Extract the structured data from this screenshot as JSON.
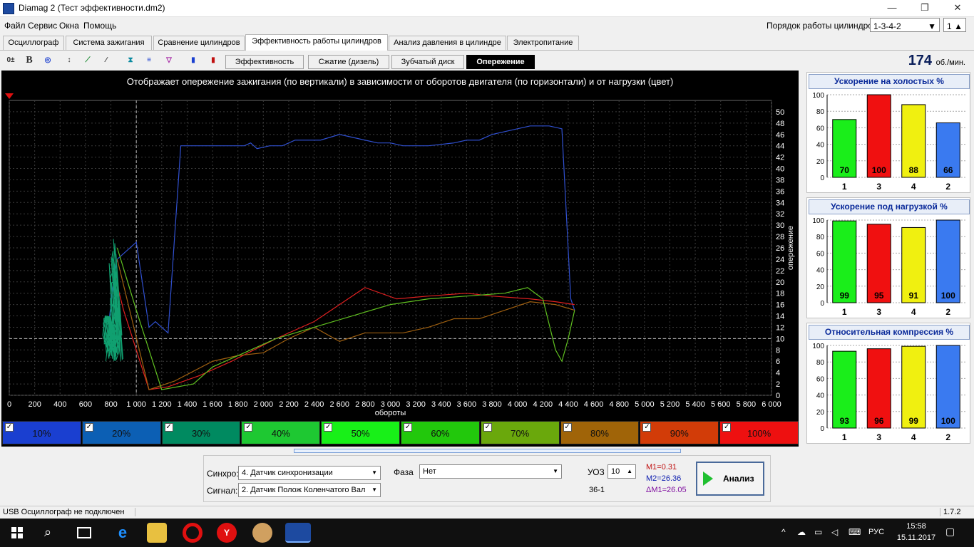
{
  "window": {
    "title": "Diamag 2 (Тест эффективности.dm2)",
    "min": "—",
    "max": "❐",
    "close": "✕"
  },
  "menu": [
    "Файл",
    "Сервис",
    "Окна",
    "Помощь"
  ],
  "firing_order": {
    "label": "Порядок работы цилиндров",
    "value": "1-3-4-2",
    "cyl_value": "1"
  },
  "main_tabs": [
    "Осциллограф",
    "Система зажигания",
    "Сравнение цилиндров",
    "Эффективность работы цилиндров",
    "Анализ давления в цилиндре",
    "Электропитание"
  ],
  "sub_tabs": [
    "Эффективность",
    "Сжатие (дизель)",
    "Зубчатый диск",
    "Опережение"
  ],
  "rpm": {
    "value": "174",
    "unit": "об./мин."
  },
  "chart_data": {
    "type": "line",
    "title": "Отображает опережение зажигания (по вертикали) в зависимости от оборотов двигателя (по горизонтали) и от нагрузки (цвет)",
    "xlabel": "обороты",
    "ylabel": "опережение",
    "xlim": [
      0,
      6000
    ],
    "ylim": [
      0,
      52
    ],
    "x_ticks": [
      "0",
      "200",
      "400",
      "600",
      "800",
      "1 000",
      "1 200",
      "1 400",
      "1 600",
      "1 800",
      "2 000",
      "2 200",
      "2 400",
      "2 600",
      "2 800",
      "3 000",
      "3 200",
      "3 400",
      "3 600",
      "3 800",
      "4 000",
      "4 200",
      "4 400",
      "4 600",
      "4 800",
      "5 000",
      "5 200",
      "5 400",
      "5 600",
      "5 800",
      "6 000"
    ],
    "y_ticks": [
      "0",
      "2",
      "4",
      "6",
      "8",
      "10",
      "12",
      "14",
      "16",
      "18",
      "20",
      "22",
      "24",
      "26",
      "28",
      "30",
      "32",
      "34",
      "36",
      "38",
      "40",
      "42",
      "44",
      "46",
      "48",
      "50"
    ],
    "series": [
      {
        "color": "#3050d0",
        "points": [
          [
            780,
            12
          ],
          [
            820,
            20
          ],
          [
            850,
            24
          ],
          [
            1000,
            27
          ],
          [
            1100,
            12
          ],
          [
            1150,
            13
          ],
          [
            1250,
            11
          ],
          [
            1350,
            44
          ],
          [
            1500,
            44
          ],
          [
            1700,
            44
          ],
          [
            1850,
            44
          ],
          [
            1900,
            44.5
          ],
          [
            1950,
            43.5
          ],
          [
            2050,
            44
          ],
          [
            2150,
            44
          ],
          [
            2250,
            45
          ],
          [
            2450,
            45
          ],
          [
            2600,
            46
          ],
          [
            2700,
            45.5
          ],
          [
            2800,
            45
          ],
          [
            2900,
            44.5
          ],
          [
            3000,
            44.5
          ],
          [
            3100,
            44
          ],
          [
            3300,
            44
          ],
          [
            3500,
            44.5
          ],
          [
            3600,
            45
          ],
          [
            3700,
            45
          ],
          [
            3800,
            46
          ],
          [
            3900,
            46.5
          ],
          [
            4000,
            47
          ],
          [
            4100,
            47.5
          ],
          [
            4250,
            47.5
          ],
          [
            4350,
            47
          ],
          [
            4420,
            17
          ],
          [
            4450,
            15
          ]
        ]
      },
      {
        "color": "#e02020",
        "points": [
          [
            820,
            22
          ],
          [
            900,
            15
          ],
          [
            1100,
            1
          ],
          [
            1250,
            1.5
          ],
          [
            1500,
            3.5
          ],
          [
            1750,
            6
          ],
          [
            2100,
            10
          ],
          [
            2400,
            13
          ],
          [
            2600,
            16
          ],
          [
            2800,
            19
          ],
          [
            3050,
            17
          ],
          [
            3300,
            17.5
          ],
          [
            3600,
            18
          ],
          [
            3800,
            17.5
          ],
          [
            4100,
            17
          ],
          [
            4300,
            16.5
          ],
          [
            4450,
            16
          ]
        ]
      },
      {
        "color": "#a06010",
        "points": [
          [
            850,
            24
          ],
          [
            1100,
            1
          ],
          [
            1300,
            2.5
          ],
          [
            1600,
            6
          ],
          [
            1800,
            7
          ],
          [
            2000,
            7.5
          ],
          [
            2200,
            10
          ],
          [
            2400,
            12
          ],
          [
            2600,
            9.5
          ],
          [
            2800,
            11
          ],
          [
            3100,
            11
          ],
          [
            3300,
            12
          ],
          [
            3500,
            13.5
          ],
          [
            3700,
            13.5
          ],
          [
            3900,
            15
          ],
          [
            4100,
            16.5
          ],
          [
            4300,
            16
          ],
          [
            4450,
            15
          ]
        ]
      },
      {
        "color": "#60c020",
        "points": [
          [
            850,
            26
          ],
          [
            1000,
            15
          ],
          [
            1200,
            1
          ],
          [
            1450,
            2
          ],
          [
            1600,
            5
          ],
          [
            1800,
            7
          ],
          [
            2100,
            10
          ],
          [
            2400,
            12
          ],
          [
            2700,
            14
          ],
          [
            3000,
            16
          ],
          [
            3300,
            17
          ],
          [
            3600,
            17.5
          ],
          [
            3900,
            18
          ],
          [
            4080,
            19
          ],
          [
            4200,
            17
          ],
          [
            4300,
            8
          ],
          [
            4350,
            6
          ],
          [
            4400,
            10
          ],
          [
            4450,
            15
          ]
        ]
      }
    ]
  },
  "load_bands": [
    {
      "label": "10%",
      "color": "#1a3fd0"
    },
    {
      "label": "20%",
      "color": "#0c5fb4"
    },
    {
      "label": "30%",
      "color": "#008a60"
    },
    {
      "label": "40%",
      "color": "#1ec832"
    },
    {
      "label": "50%",
      "color": "#18f018"
    },
    {
      "label": "60%",
      "color": "#22c80c"
    },
    {
      "label": "70%",
      "color": "#6aa80c"
    },
    {
      "label": "80%",
      "color": "#a06408"
    },
    {
      "label": "90%",
      "color": "#d23c08"
    },
    {
      "label": "100%",
      "color": "#ee1010"
    }
  ],
  "side_charts": [
    {
      "title": "Ускорение на холостых %",
      "bars": [
        {
          "cyl": "1",
          "value": 70,
          "color": "#1aee1a"
        },
        {
          "cyl": "3",
          "value": 100,
          "color": "#f01010"
        },
        {
          "cyl": "4",
          "value": 88,
          "color": "#f0f010"
        },
        {
          "cyl": "2",
          "value": 66,
          "color": "#3a7af0"
        }
      ]
    },
    {
      "title": "Ускорение под нагрузкой %",
      "bars": [
        {
          "cyl": "1",
          "value": 99,
          "color": "#1aee1a"
        },
        {
          "cyl": "3",
          "value": 95,
          "color": "#f01010"
        },
        {
          "cyl": "4",
          "value": 91,
          "color": "#f0f010"
        },
        {
          "cyl": "2",
          "value": 100,
          "color": "#3a7af0"
        }
      ]
    },
    {
      "title": "Относительная компрессия %",
      "bars": [
        {
          "cyl": "1",
          "value": 93,
          "color": "#1aee1a"
        },
        {
          "cyl": "3",
          "value": 96,
          "color": "#f01010"
        },
        {
          "cyl": "4",
          "value": 99,
          "color": "#f0f010"
        },
        {
          "cyl": "2",
          "value": 100,
          "color": "#3a7af0"
        }
      ]
    }
  ],
  "side_yticks": [
    "0",
    "20",
    "40",
    "60",
    "80",
    "100"
  ],
  "controls": {
    "sync_label": "Синхро:",
    "sync_value": "4. Датчик синхронизации",
    "signal_label": "Сигнал:",
    "signal_value": "2. Датчик Полож Коленчатого Вал",
    "phase_label": "Фаза",
    "phase_value": "Нет",
    "uoz_label": "УОЗ",
    "uoz_value": "10",
    "teeth": "36-1",
    "m1": "M1=0.31",
    "m2": "M2=26.36",
    "dm1": "ΔM1=26.05",
    "analyze": "Анализ"
  },
  "status": {
    "text": "USB Осциллограф не подключен",
    "version": "1.7.2"
  },
  "taskbar": {
    "lang": "РУС",
    "time": "15:58",
    "date": "15.11.2017"
  }
}
